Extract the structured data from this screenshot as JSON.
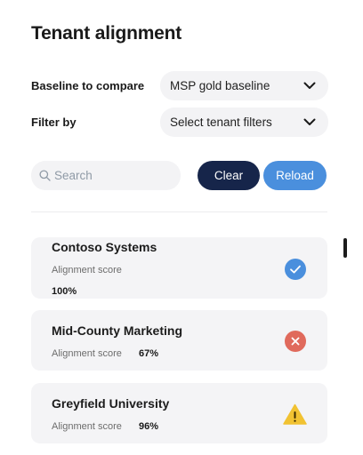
{
  "page": {
    "title": "Tenant alignment"
  },
  "baseline": {
    "label": "Baseline to compare",
    "value": "MSP gold baseline"
  },
  "filter": {
    "label": "Filter by",
    "value": "Select tenant filters"
  },
  "search": {
    "placeholder": "Search"
  },
  "actions": {
    "clear_label": "Clear",
    "reload_label": "Reload"
  },
  "tenants": [
    {
      "name": "Contoso Systems",
      "score_label": "Alignment score",
      "score": "100%",
      "status": "aligned",
      "status_icon": "check-circle-icon",
      "status_color": "#4a8fdd"
    },
    {
      "name": "Mid-County Marketing",
      "score_label": "Alignment score",
      "score": "67%",
      "status": "not-aligned",
      "status_icon": "error-circle-icon",
      "status_color": "#e06a5c"
    },
    {
      "name": "Greyfield University",
      "score_label": "Alignment score",
      "score": "96%",
      "status": "warning",
      "status_icon": "warning-triangle-icon",
      "status_color": "#f1c232"
    }
  ],
  "colors": {
    "primary_dark": "#16254a",
    "primary_blue": "#4a8fdd"
  }
}
